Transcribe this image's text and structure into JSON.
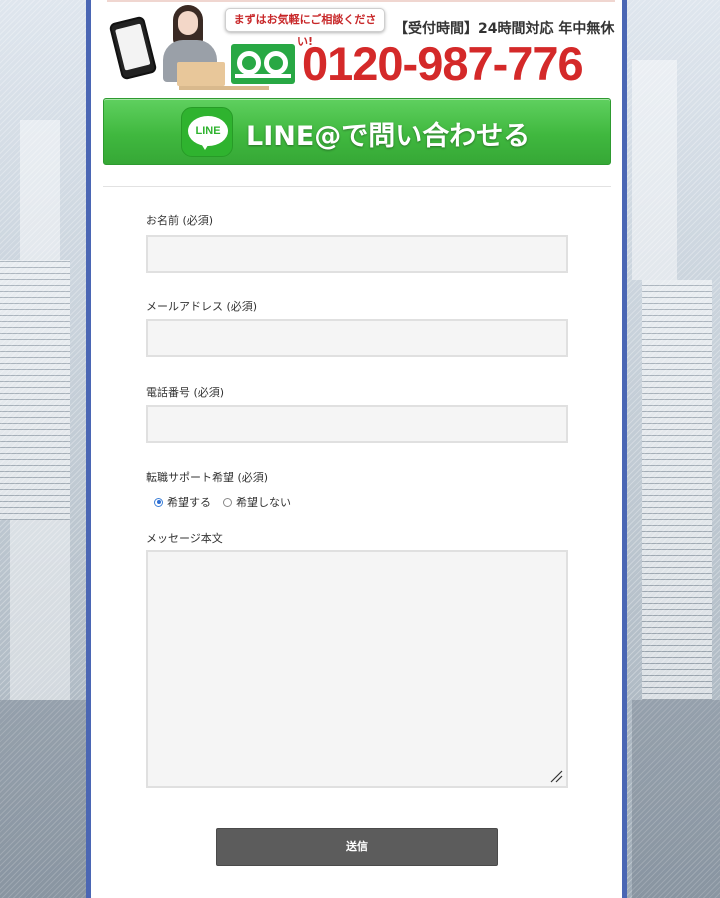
{
  "banner": {
    "bubble_text": "まずはお気軽にご相談ください!",
    "hours_text": "【受付時間】24時間対応 年中無休",
    "phone_number": "0120-987-776"
  },
  "line_button": {
    "icon_text": "LINE",
    "label": "LINE@で問い合わせる"
  },
  "form": {
    "name_label": "お名前 (必須)",
    "name_value": "",
    "email_label": "メールアドレス (必須)",
    "email_value": "",
    "phone_label": "電話番号 (必須)",
    "phone_value": "",
    "support_label": "転職サポート希望 (必須)",
    "support_options": [
      {
        "label": "希望する",
        "checked": true
      },
      {
        "label": "希望しない",
        "checked": false
      }
    ],
    "message_label": "メッセージ本文",
    "message_value": "",
    "submit_label": "送信"
  },
  "colors": {
    "frame_border": "#4a66b4",
    "phone_red": "#d42929",
    "line_green": "#40b83f",
    "freedial_green": "#28a844",
    "submit_gray": "#5c5c5c"
  }
}
